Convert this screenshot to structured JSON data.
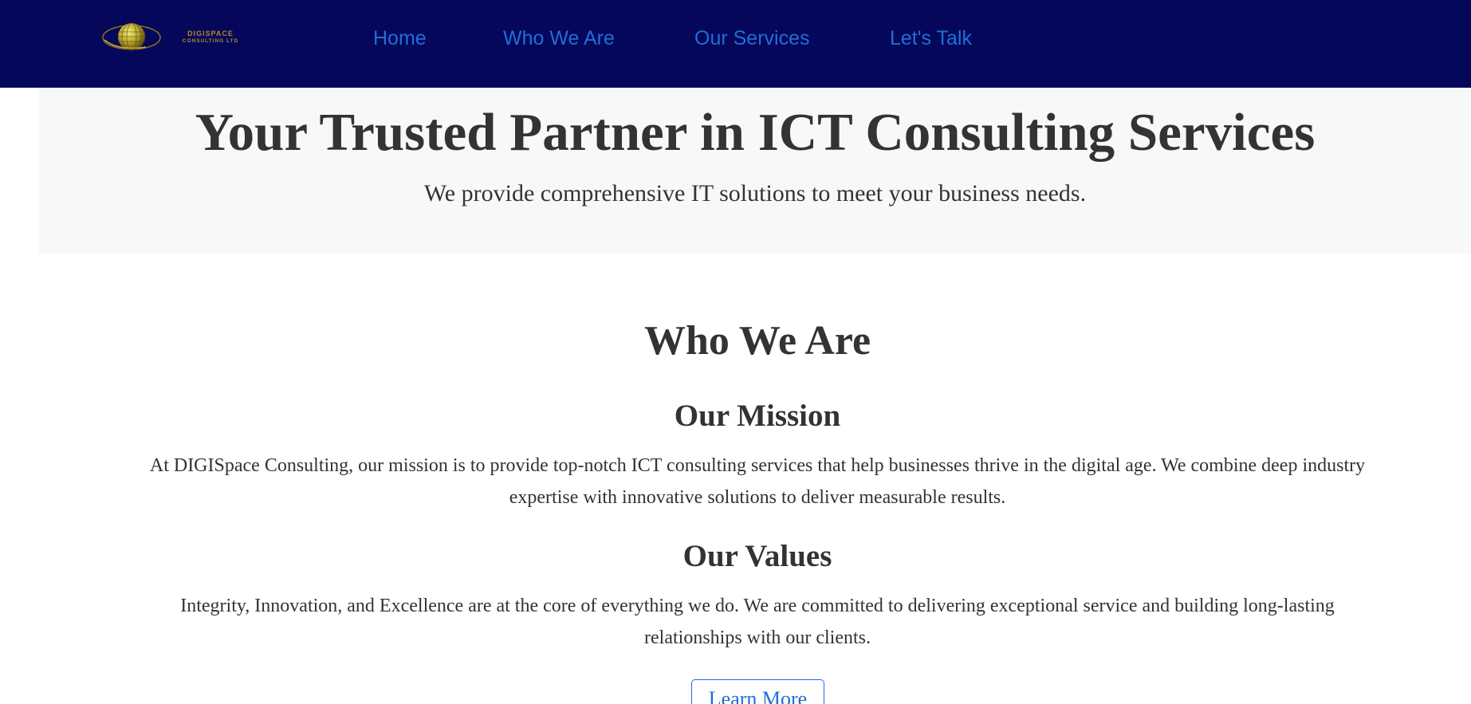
{
  "header": {
    "logo": {
      "line1": "DIGISPACE",
      "line2": "CONSULTING LTD"
    },
    "nav": {
      "home": "Home",
      "who_we_are": "Who We Are",
      "services": "Our Services",
      "lets_talk": "Let's Talk"
    }
  },
  "hero": {
    "title": "Your Trusted Partner in ICT Consulting Services",
    "subtitle": "We provide comprehensive IT solutions to meet your business needs."
  },
  "about": {
    "title": "Who We Are",
    "mission_title": "Our Mission",
    "mission_text": "At DIGISpace Consulting, our mission is to provide top-notch ICT consulting services that help businesses thrive in the digital age. We combine deep industry expertise with innovative solutions to deliver measurable results.",
    "values_title": "Our Values",
    "values_text": "Integrity, Innovation, and Excellence are at the core of everything we do. We are committed to delivering exceptional service and building long-lasting relationships with our clients.",
    "learn_more": "Learn More"
  },
  "colors": {
    "navbar_bg": "#05075b",
    "nav_link": "#1f6fd6",
    "hero_bg": "#f7f8fa",
    "text": "#333333",
    "logo_gold": "#b08a2a"
  }
}
